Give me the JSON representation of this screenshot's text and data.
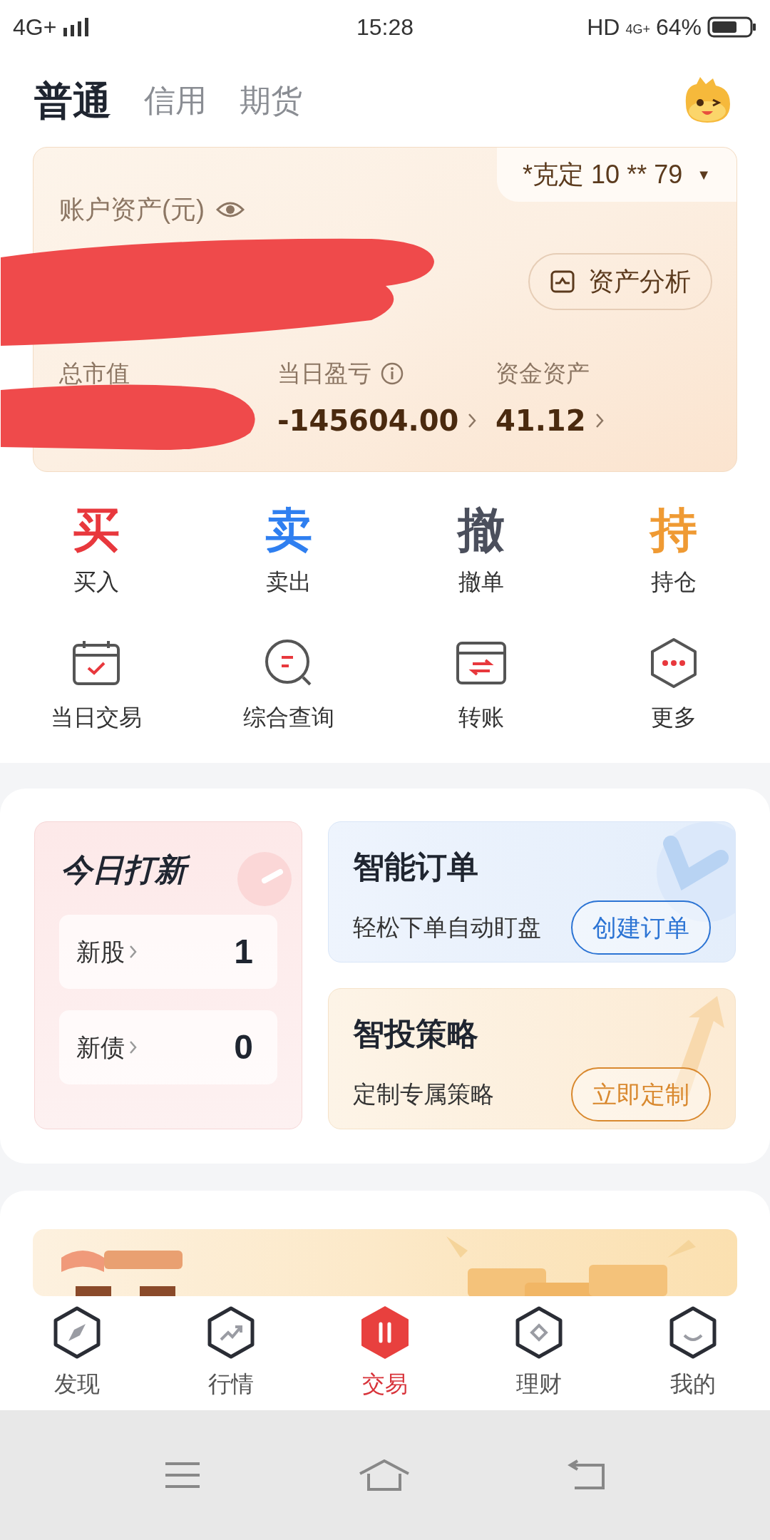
{
  "status_bar": {
    "network": "4G+",
    "time": "15:28",
    "hd": "HD",
    "network_right": "4G+",
    "battery": "64%"
  },
  "tabs": [
    {
      "label": "普通",
      "selected": true
    },
    {
      "label": "信用",
      "selected": false
    },
    {
      "label": "期货",
      "selected": false
    }
  ],
  "account": {
    "selector": "*克定 10 ** 79",
    "caret": "▼",
    "title": "账户资产(元)",
    "analysis_button": "资产分析",
    "stats": [
      {
        "label": "总市值",
        "info": false
      },
      {
        "label": "当日盈亏",
        "info": true,
        "value": "-145604.00"
      },
      {
        "label": "资金资产",
        "info": false,
        "value": "41.12"
      }
    ]
  },
  "quick_actions": [
    {
      "glyph": "买",
      "label": "买入",
      "color": "#e8383d"
    },
    {
      "glyph": "卖",
      "label": "卖出",
      "color": "#2f7ff0"
    },
    {
      "glyph": "撤",
      "label": "撤单",
      "color": "#4b4f5c"
    },
    {
      "glyph": "持",
      "label": "持仓",
      "color": "#ef9a33"
    }
  ],
  "tools": [
    {
      "kind": "calendar",
      "label": "当日交易"
    },
    {
      "kind": "search",
      "label": "综合查询"
    },
    {
      "kind": "transfer",
      "label": "转账"
    },
    {
      "kind": "more",
      "label": "更多"
    }
  ],
  "ipo": {
    "title": "今日打新",
    "rows": [
      {
        "label": "新股",
        "count": "1"
      },
      {
        "label": "新债",
        "count": "0"
      }
    ]
  },
  "promos": [
    {
      "kind": "order",
      "title": "智能订单",
      "subtitle": "轻松下单自动盯盘",
      "button": "创建订单"
    },
    {
      "kind": "strategy",
      "title": "智投策略",
      "subtitle": "定制专属策略",
      "button": "立即定制"
    }
  ],
  "bottom_nav": [
    {
      "kind": "compass",
      "label": "发现",
      "selected": false
    },
    {
      "kind": "trend",
      "label": "行情",
      "selected": false
    },
    {
      "kind": "trade",
      "label": "交易",
      "selected": true
    },
    {
      "kind": "diamond",
      "label": "理财",
      "selected": false
    },
    {
      "kind": "smile",
      "label": "我的",
      "selected": false
    }
  ]
}
